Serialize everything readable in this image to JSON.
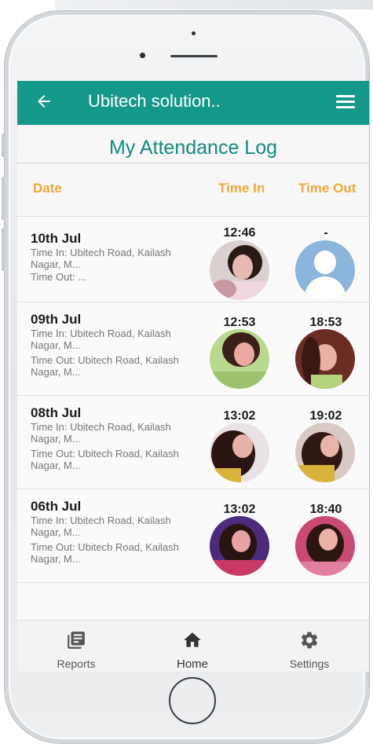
{
  "appbar": {
    "title": "Ubitech solution..",
    "back_icon": "arrow-left-icon",
    "menu_icon": "hamburger-menu-icon",
    "color": "#13988a"
  },
  "page": {
    "title": "My Attendance Log"
  },
  "columns": {
    "date": "Date",
    "time_in": "Time In",
    "time_out": "Time Out",
    "color": "#f2a93b"
  },
  "rows": [
    {
      "date": "10th Jul",
      "time_in_line": "Time In: Ubitech Road, Kailash Nagar, M...",
      "time_out_line": "Time Out: ...",
      "time_in": "12:46",
      "time_out": "-"
    },
    {
      "date": "09th Jul",
      "time_in_line": "Time In: Ubitech Road, Kailash Nagar, M...",
      "time_out_line": "Time Out: Ubitech Road, Kailash Nagar, M...",
      "time_in": "12:53",
      "time_out": "18:53"
    },
    {
      "date": "08th Jul",
      "time_in_line": "Time In: Ubitech Road, Kailash Nagar, M...",
      "time_out_line": "Time Out: Ubitech Road, Kailash Nagar, M...",
      "time_in": "13:02",
      "time_out": "19:02"
    },
    {
      "date": "06th Jul",
      "time_in_line": "Time In: Ubitech Road, Kailash Nagar, M...",
      "time_out_line": "Time Out: Ubitech Road, Kailash Nagar, M...",
      "time_in": "13:02",
      "time_out": "18:40"
    }
  ],
  "bottom_nav": {
    "reports": {
      "label": "Reports",
      "icon": "reports-icon"
    },
    "home": {
      "label": "Home",
      "icon": "home-icon"
    },
    "settings": {
      "label": "Settings",
      "icon": "gear-icon"
    }
  }
}
